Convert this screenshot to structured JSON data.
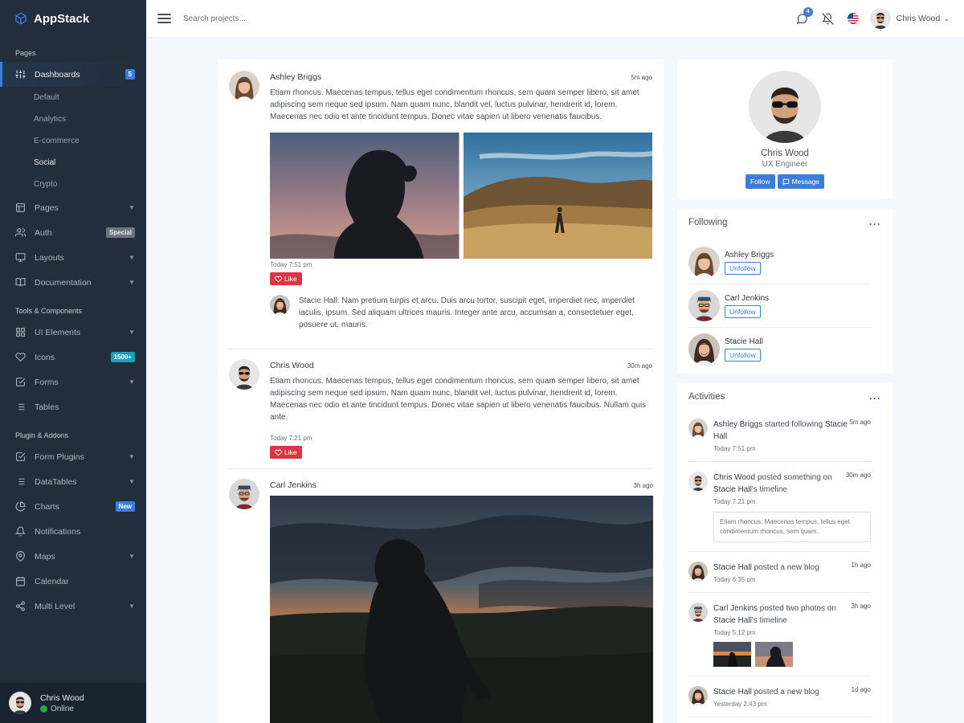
{
  "brand": {
    "name": "AppStack",
    "accent": "#3b7ddd"
  },
  "sidebar": {
    "background": "#222e3c",
    "sections": [
      "Pages",
      "Tools & Components",
      "Plugin & Addons"
    ],
    "items": [
      {
        "label": "Dashboards",
        "icon": "sliders-icon",
        "badge": "5"
      },
      {
        "label": "Pages",
        "icon": "layout-icon"
      },
      {
        "label": "Auth",
        "icon": "users-icon",
        "badge": "Special"
      },
      {
        "label": "Layouts",
        "icon": "monitor-icon"
      },
      {
        "label": "Documentation",
        "icon": "book-icon"
      },
      {
        "label": "UI Elements",
        "icon": "grid-icon"
      },
      {
        "label": "Icons",
        "icon": "heart-icon",
        "badge": "1500+"
      },
      {
        "label": "Forms",
        "icon": "check-square-icon"
      },
      {
        "label": "Tables",
        "icon": "list-icon"
      },
      {
        "label": "Form Plugins",
        "icon": "check-square-icon"
      },
      {
        "label": "DataTables",
        "icon": "list-icon"
      },
      {
        "label": "Charts",
        "icon": "pie-chart-icon",
        "badge": "New"
      },
      {
        "label": "Notifications",
        "icon": "bell-icon"
      },
      {
        "label": "Maps",
        "icon": "map-pin-icon"
      },
      {
        "label": "Calendar",
        "icon": "calendar-icon"
      },
      {
        "label": "Multi Level",
        "icon": "share-icon"
      }
    ],
    "dashboard_sub": [
      "Default",
      "Analytics",
      "E-commerce",
      "Social",
      "Crypto"
    ],
    "user": {
      "name": "Chris Wood",
      "status": "Online"
    }
  },
  "topbar": {
    "search_placeholder": "Search projects...",
    "messages_count": "4",
    "user_name": "Chris Wood"
  },
  "feed": {
    "posts": [
      {
        "author": "Ashley Briggs",
        "time": "5m ago",
        "text": "Etiam rhoncus. Maecenas tempus, tellus eget condimentum rhoncus, sem quam semper libero, sit amet adipiscing sem neque sed ipsum. Nam quam nunc, blandit vel, luctus pulvinar, hendrerit id, lorem. Maecenas nec odio et ante tincidunt tempus. Donec vitae sapien ut libero venenatis faucibus.",
        "date": "Today 7:51 pm",
        "like_label": "Like",
        "comment": "Stacie Hall: Nam pretium turpis et arcu. Duis arcu tortor, suscipit eget, imperdiet nec, imperdiet iaculis, ipsum. Sed aliquam ultrices mauris. Integer ante arcu, accumsan a, consectetuer eget, posuere ut, mauris."
      },
      {
        "author": "Chris Wood",
        "time": "30m ago",
        "text": "Etiam rhoncus. Maecenas tempus, tellus eget condimentum rhoncus, sem quam semper libero, sit amet adipiscing sem neque sed ipsum. Nam quam nunc, blandit vel, luctus pulvinar, hendrerit id, lorem. Maecenas nec odio et ante tincidunt tempus. Donec vitae sapien ut libero venenatis faucibus. Nullam quis ante.",
        "date": "Today 7:21 pm",
        "like_label": "Like"
      },
      {
        "author": "Carl Jenkins",
        "time": "3h ago"
      }
    ]
  },
  "profile": {
    "name": "Chris Wood",
    "role": "UX Engineer",
    "follow_label": "Follow",
    "message_label": "Message"
  },
  "following": {
    "title": "Following",
    "unfollow_label": "Unfollow",
    "people": [
      "Ashley Briggs",
      "Carl Jenkins",
      "Stacie Hall"
    ]
  },
  "activities": {
    "title": "Activities",
    "items": [
      {
        "actor": "Ashley Briggs",
        "action": " started following ",
        "target": "Stacie Hall",
        "suffix": "",
        "time": "5m ago",
        "date": "Today 7:51 pm"
      },
      {
        "actor": "Chris Wood",
        "action": " posted something on ",
        "target": "Stacie Hall",
        "suffix": "'s timeline",
        "time": "30m ago",
        "date": "Today 7:21 pm",
        "quote": "Etiam rhoncus. Maecenas tempus, tellus eget condimentum rhoncus, sem quam.."
      },
      {
        "actor": "Stacie Hall",
        "action": " posted a new blog",
        "target": "",
        "suffix": "",
        "time": "1h ago",
        "date": "Today 6:35 pm"
      },
      {
        "actor": "Carl Jenkins",
        "action": " posted two photos on ",
        "target": "Stacie Hall",
        "suffix": "'s timeline",
        "time": "3h ago",
        "date": "Today 5:12 pm"
      },
      {
        "actor": "Stacie Hall",
        "action": " posted a new blog",
        "target": "",
        "suffix": "",
        "time": "1d ago",
        "date": "Yesterday 2:43 pm"
      }
    ]
  }
}
